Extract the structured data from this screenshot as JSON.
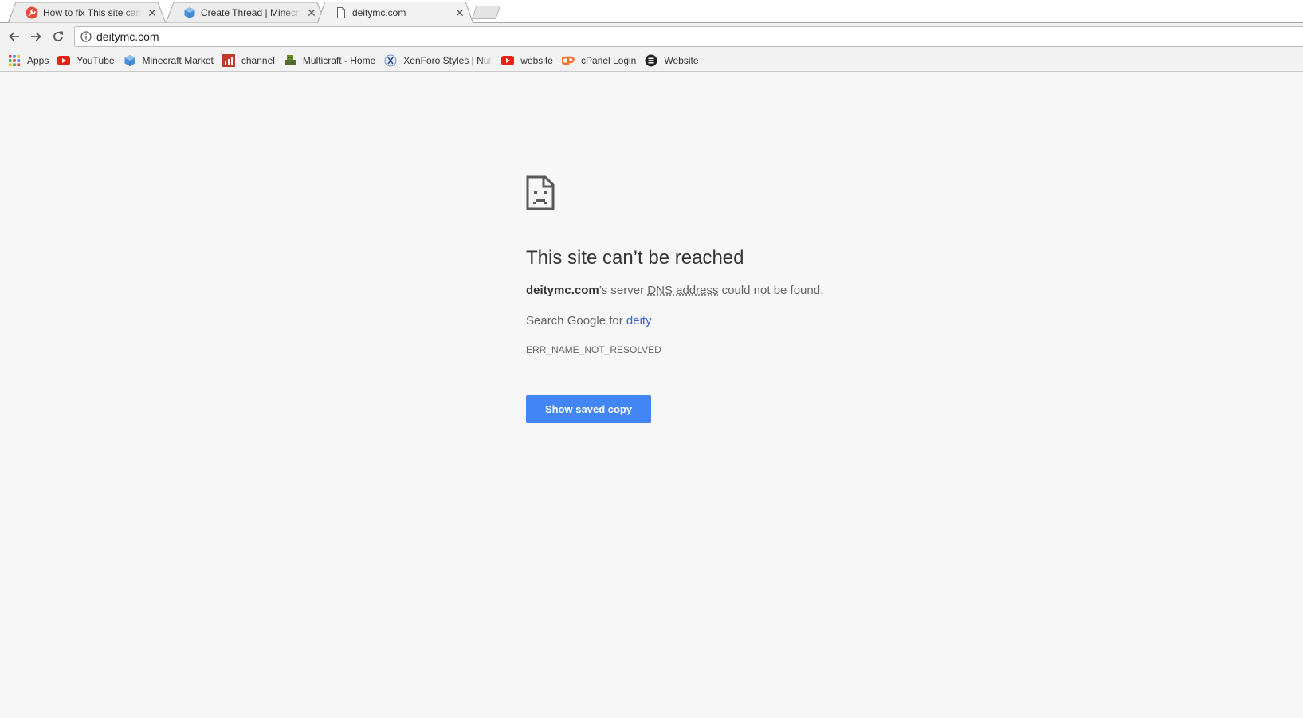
{
  "browser": {
    "tabs": [
      {
        "title": "How to fix This site can't be reached",
        "icon": "tools-icon",
        "active": false
      },
      {
        "title": "Create Thread | Minecraft Market",
        "icon": "cube-icon",
        "active": false
      },
      {
        "title": "deitymc.com",
        "icon": "page-icon",
        "active": true
      }
    ],
    "close_glyph": "✕",
    "address": "deitymc.com"
  },
  "bookmarks": [
    {
      "label": "Apps",
      "icon": "apps-grid-icon"
    },
    {
      "label": "YouTube",
      "icon": "youtube-icon"
    },
    {
      "label": "Minecraft Market",
      "icon": "cube-icon"
    },
    {
      "label": "channel",
      "icon": "chart-icon"
    },
    {
      "label": "Multicraft - Home",
      "icon": "multicraft-icon"
    },
    {
      "label": "XenForo Styles | Nulled",
      "icon": "xenforo-icon"
    },
    {
      "label": "website",
      "icon": "youtube-icon"
    },
    {
      "label": "cPanel Login",
      "icon": "cpanel-icon"
    },
    {
      "label": "Website",
      "icon": "circle-e-icon"
    }
  ],
  "error": {
    "title": "This site can’t be reached",
    "domain": "deitymc.com",
    "desc_mid": "’s server ",
    "desc_dns": "DNS address",
    "desc_end": " could not be found.",
    "search_prefix": "Search Google for ",
    "search_term": "deity",
    "code": "ERR_NAME_NOT_RESOLVED",
    "button_label": "Show saved copy"
  },
  "colors": {
    "accent": "#4285f4",
    "link": "#3367d6",
    "page_bg": "#f7f7f7"
  }
}
